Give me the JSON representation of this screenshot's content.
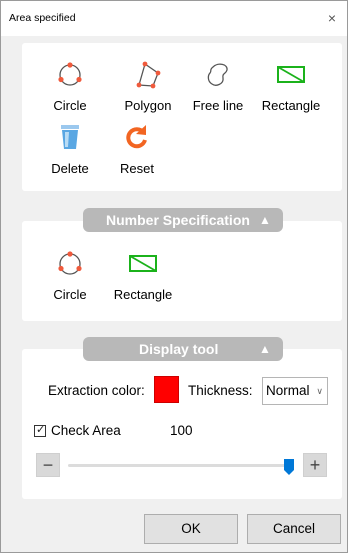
{
  "window": {
    "title": "Area specified",
    "close_icon": "×"
  },
  "tools": {
    "circle": "Circle",
    "polygon": "Polygon",
    "free_line": "Free line",
    "rectangle": "Rectangle",
    "delete": "Delete",
    "reset": "Reset"
  },
  "number_spec": {
    "header": "Number Specification",
    "header_icon": "▲",
    "circle": "Circle",
    "rectangle": "Rectangle"
  },
  "display_tool": {
    "header": "Display tool",
    "header_icon": "▲",
    "extraction_color_label": "Extraction color:",
    "extraction_color": "#ff0000",
    "thickness_label": "Thickness:",
    "thickness_value": "Normal",
    "check_area_label": "Check Area",
    "check_area_checked": true,
    "check_area_value": "100",
    "slider_fraction": 1.0,
    "minus_label": "−",
    "plus_label": "+"
  },
  "buttons": {
    "ok": "OK",
    "cancel": "Cancel"
  },
  "colors": {
    "accent_blue": "#0078d7",
    "shape_red": "#f05a3c",
    "shape_green": "#1bb21b",
    "reset_orange": "#f26522",
    "header_gray": "#b8b8b8"
  }
}
